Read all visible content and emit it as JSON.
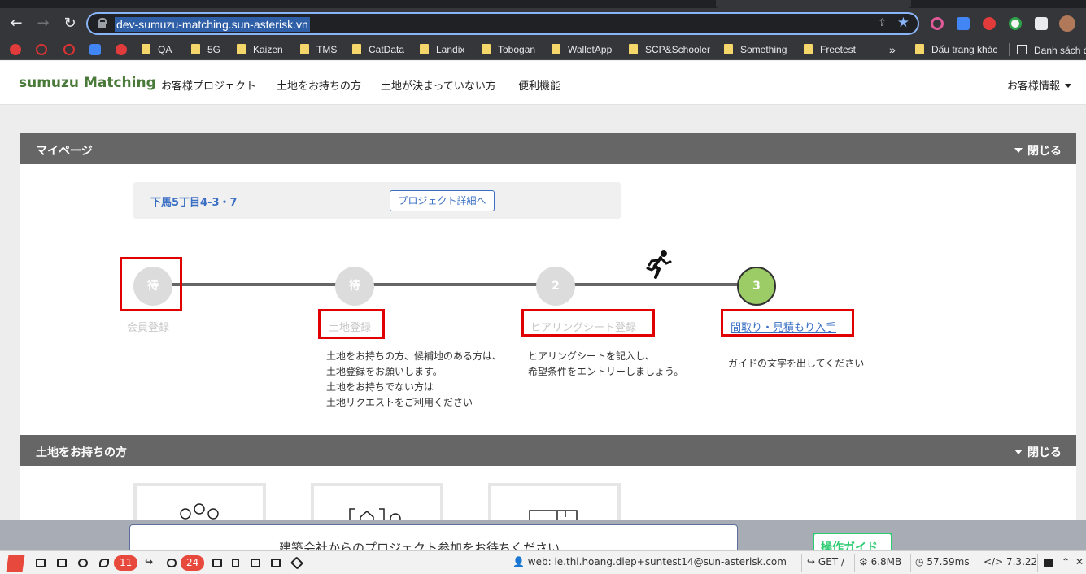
{
  "browser": {
    "url": "dev-sumuzu-matching.sun-asterisk.vn",
    "bookmarks": [
      "QA",
      "5G",
      "Kaizen",
      "TMS",
      "CatData",
      "Landix",
      "Tobogan",
      "WalletApp",
      "SCP&Schooler",
      "Something",
      "Freetest"
    ],
    "more_bookmarks": "»",
    "other_bookmarks": "Dấu trang khác",
    "reading_list": "Danh sách đ"
  },
  "site": {
    "brand": "sumuzu Matching",
    "nav": [
      "お客様プロジェクト",
      "土地をお持ちの方",
      "土地が決まっていない方",
      "便利機能"
    ],
    "account": "お客様情報"
  },
  "mypage": {
    "title": "マイページ",
    "close": "閉じる",
    "project_name": "下馬5丁目4-3・7",
    "detail_button": "プロジェクト詳細へ",
    "steps": [
      {
        "marker": "待",
        "label": "会員登録",
        "state": "waiting"
      },
      {
        "marker": "待",
        "label": "土地登録",
        "state": "waiting"
      },
      {
        "marker": "2",
        "label": "ヒアリングシート登録",
        "state": "upcoming"
      },
      {
        "marker": "3",
        "label": "間取り・見積もり入手",
        "state": "current"
      }
    ],
    "desc_land": [
      "土地をお持ちの方、候補地のある方は、",
      "土地登録をお願いします。",
      "土地をお持ちでない方は",
      "土地リクエストをご利用ください"
    ],
    "desc_hearing": [
      "ヒアリングシートを記入し、",
      "希望条件をエントリーしましょう。"
    ],
    "desc_guide": "ガイドの文字を出してください"
  },
  "land_owner": {
    "title": "土地をお持ちの方",
    "close": "閉じる"
  },
  "overlay": {
    "message": "建築会社からのプロジェクト参加をお待ちください",
    "guide_button": "操作ガイド"
  },
  "debugbar": {
    "badge_logs": "11",
    "badge_queries": "24",
    "user": "web: le.thi.hoang.diep+suntest14@sun-asterisk.com",
    "method": "GET",
    "path_sep": "/",
    "memory": "6.8MB",
    "time": "57.59ms",
    "php_version": "7.3.22"
  },
  "colors": {
    "brand_green": "#4a7a3a",
    "link_blue": "#3a6fc4",
    "panel_gray": "#666666",
    "step_current": "#9ccc65",
    "highlight_red": "#e00000",
    "guide_green": "#2ecc71"
  }
}
